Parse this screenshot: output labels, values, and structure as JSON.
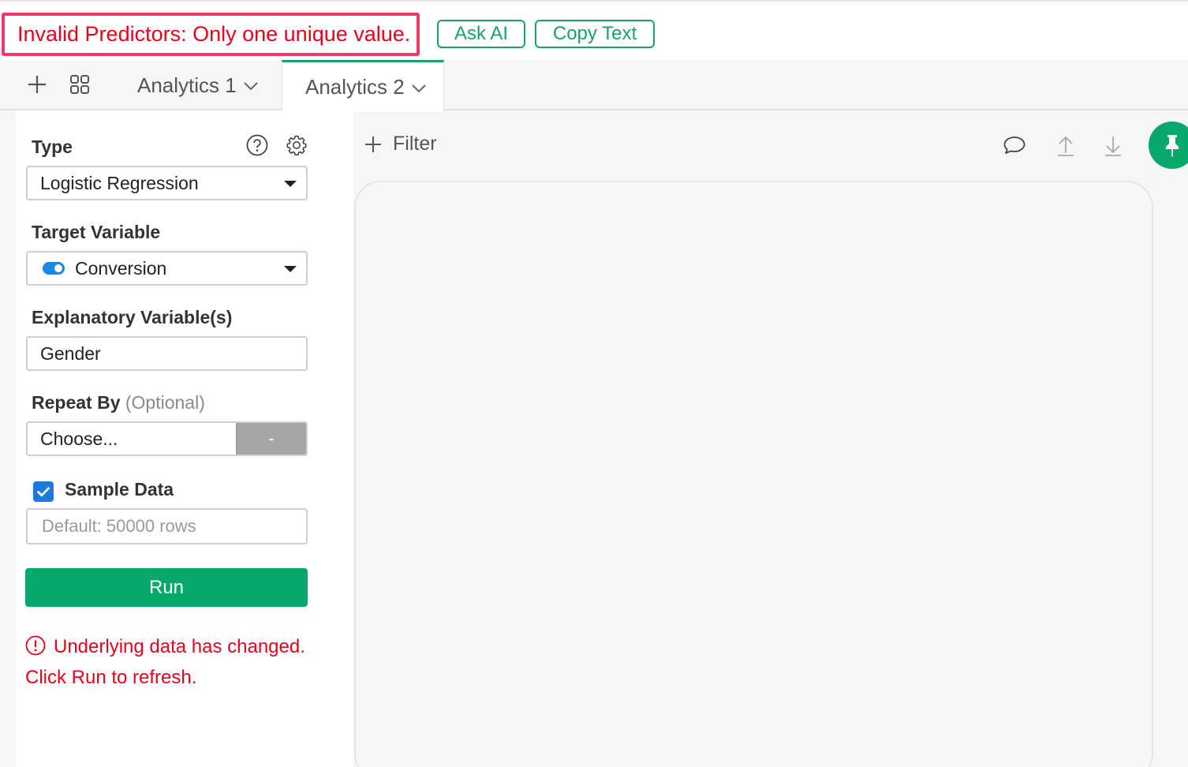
{
  "error": {
    "message": "Invalid Predictors: Only one unique value.",
    "ask_ai_label": "Ask AI",
    "copy_text_label": "Copy Text"
  },
  "tabs": [
    {
      "label": "Analytics 1",
      "active": false
    },
    {
      "label": "Analytics 2",
      "active": true
    }
  ],
  "panel": {
    "type_label": "Type",
    "type_value": "Logistic Regression",
    "target_label": "Target Variable",
    "target_value": "Conversion",
    "explanatory_label": "Explanatory Variable(s)",
    "explanatory_value": "Gender",
    "repeat_label": "Repeat By",
    "repeat_optional": "(Optional)",
    "repeat_value": "Choose...",
    "repeat_button": "-",
    "sample_label": "Sample Data",
    "sample_checked": true,
    "sample_placeholder": "Default: 50000 rows",
    "run_label": "Run",
    "warning": "Underlying data has changed. Click Run to refresh."
  },
  "toolbar": {
    "filter_label": "Filter"
  },
  "colors": {
    "accent": "#06a86b",
    "error": "#e8001c",
    "error_border": "#f0386b",
    "toggle": "#1a8ae0"
  },
  "icons": [
    "plus-icon",
    "grid-icon",
    "chevron-down-icon",
    "help-icon",
    "gear-icon",
    "comment-icon",
    "upload-icon",
    "download-icon",
    "pin-icon",
    "alert-icon"
  ]
}
